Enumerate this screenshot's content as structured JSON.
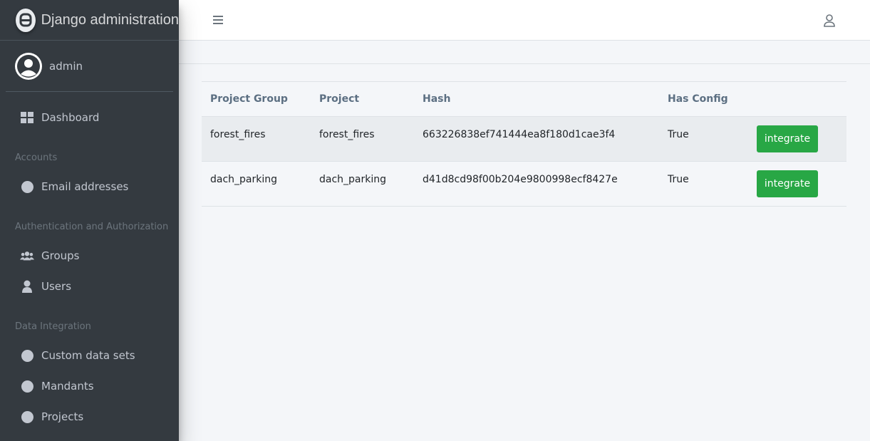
{
  "brand": {
    "title": "Django administration",
    "logo_icon": "django-logo-icon"
  },
  "user": {
    "name": "admin",
    "avatar_icon": "user-circle-icon"
  },
  "sidebar": {
    "dashboard": {
      "label": "Dashboard",
      "icon": "grid-icon"
    },
    "sections": [
      {
        "header": "Accounts",
        "items": [
          {
            "label": "Email addresses",
            "icon": "circle-icon"
          }
        ]
      },
      {
        "header": "Authentication and Authorization",
        "items": [
          {
            "label": "Groups",
            "icon": "users-icon"
          },
          {
            "label": "Users",
            "icon": "user-icon"
          }
        ]
      },
      {
        "header": "Data Integration",
        "items": [
          {
            "label": "Custom data sets",
            "icon": "circle-icon"
          },
          {
            "label": "Mandants",
            "icon": "circle-icon"
          },
          {
            "label": "Projects",
            "icon": "circle-icon"
          }
        ]
      }
    ]
  },
  "topbar": {
    "menu_icon": "hamburger-icon",
    "user_menu_icon": "user-outline-icon"
  },
  "table": {
    "columns": [
      "Project Group",
      "Project",
      "Hash",
      "Has Config",
      ""
    ],
    "rows": [
      {
        "project_group": "forest_fires",
        "project": "forest_fires",
        "hash": "663226838ef741444ea8f180d1cae3f4",
        "has_config": "True",
        "action": "integrate"
      },
      {
        "project_group": "dach_parking",
        "project": "dach_parking",
        "hash": "d41d8cd98f00b204e9800998ecf8427e",
        "has_config": "True",
        "action": "integrate"
      }
    ]
  },
  "colors": {
    "sidebar_bg": "#343a40",
    "accent_success": "#28a745",
    "page_bg": "#f4f6f9"
  }
}
